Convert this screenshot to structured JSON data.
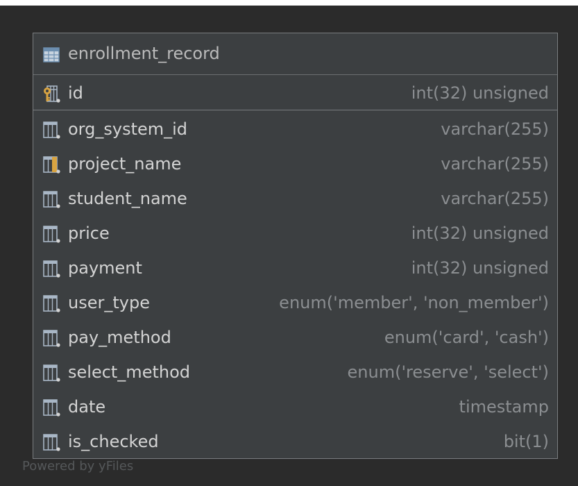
{
  "table": {
    "name": "enrollment_record",
    "icon": "table-grid-icon",
    "primary_key": {
      "name": "id",
      "type": "int(32) unsigned",
      "icon": "primary-key-column-icon"
    },
    "columns": [
      {
        "name": "org_system_id",
        "type": "varchar(255)",
        "icon": "column-icon"
      },
      {
        "name": "project_name",
        "type": "varchar(255)",
        "icon": "index-column-icon"
      },
      {
        "name": "student_name",
        "type": "varchar(255)",
        "icon": "column-icon"
      },
      {
        "name": "price",
        "type": "int(32) unsigned",
        "icon": "column-icon"
      },
      {
        "name": "payment",
        "type": "int(32) unsigned",
        "icon": "column-icon"
      },
      {
        "name": "user_type",
        "type": "enum('member', 'non_member')",
        "icon": "column-icon"
      },
      {
        "name": "pay_method",
        "type": "enum('card', 'cash')",
        "icon": "column-icon"
      },
      {
        "name": "select_method",
        "type": "enum('reserve', 'select')",
        "icon": "column-icon"
      },
      {
        "name": "date",
        "type": "timestamp",
        "icon": "column-icon"
      },
      {
        "name": "is_checked",
        "type": "bit(1)",
        "icon": "column-icon"
      }
    ]
  },
  "watermark": "Powered by yFiles",
  "colors": {
    "background": "#2b2b2b",
    "node_fill": "#3c3f41",
    "border": "#7a7d80",
    "column_name": "#d4d4d4",
    "column_type": "#8b8e91",
    "key_gold": "#d9a441",
    "grid_icon": "#a9b7c6"
  }
}
